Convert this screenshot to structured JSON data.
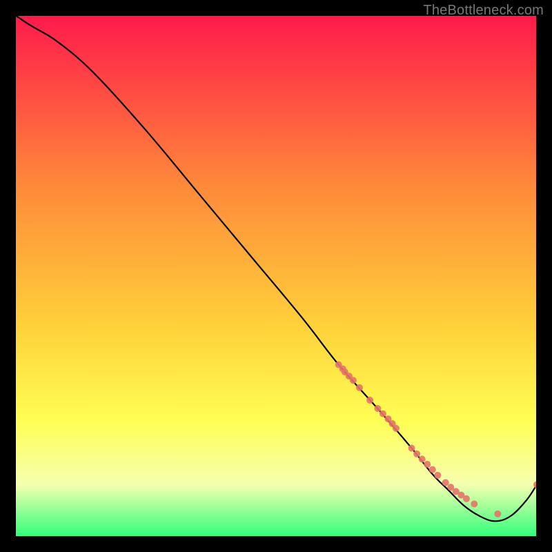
{
  "watermark": "TheBottleneck.com",
  "colors": {
    "gradient_top": "#ff1a4b",
    "gradient_mid1": "#ff6a3a",
    "gradient_mid2": "#ffd23a",
    "gradient_mid3": "#ffff55",
    "gradient_band": "#f5ffb0",
    "gradient_bottom": "#2eff7a",
    "curve": "#000000",
    "point": "#e57368",
    "frame": "#000000",
    "page_bg": "#000000"
  },
  "chart_data": {
    "type": "line",
    "title": "",
    "xlabel": "",
    "ylabel": "",
    "xlim": [
      0,
      100
    ],
    "ylim": [
      0,
      100
    ],
    "grid": false,
    "legend": null,
    "series": [
      {
        "name": "bottleneck-curve",
        "x": [
          0,
          3,
          8,
          15,
          25,
          35,
          45,
          55,
          62,
          70,
          76,
          80,
          83,
          86,
          89,
          92,
          95,
          98,
          100
        ],
        "y": [
          100,
          98,
          95,
          89,
          78,
          66,
          54,
          42,
          33,
          24,
          17,
          12,
          9,
          6,
          4,
          3,
          4,
          7,
          10
        ]
      }
    ],
    "points": {
      "name": "sample-dots",
      "x": [
        62,
        62.8,
        63.2,
        64,
        64.8,
        66,
        68,
        69.5,
        70.5,
        71.5,
        72.3,
        73,
        76,
        77,
        78,
        79,
        80,
        81,
        82.5,
        83.5,
        84.5,
        85.5,
        86.5,
        88,
        92.5,
        100
      ],
      "y": [
        33,
        32.2,
        31.6,
        30.8,
        30,
        28.6,
        26.2,
        24.6,
        23.6,
        22.6,
        21.7,
        20.8,
        17,
        15.9,
        14.9,
        13.9,
        12.9,
        11.8,
        10.4,
        9.5,
        8.7,
        8,
        7.3,
        6.3,
        4.4,
        10
      ]
    }
  }
}
